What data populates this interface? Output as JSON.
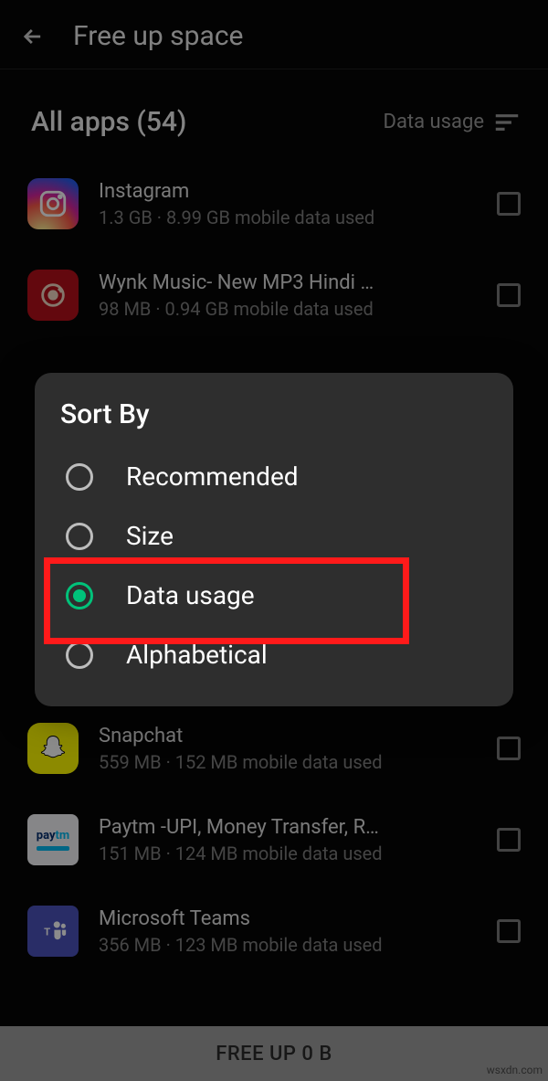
{
  "header": {
    "title": "Free up space"
  },
  "section": {
    "title": "All apps (54)",
    "sort_label": "Data usage"
  },
  "apps": [
    {
      "name": "Instagram",
      "sub": "1.3 GB · 8.99 GB mobile data used"
    },
    {
      "name": "Wynk Music- New MP3 Hindi …",
      "sub": "98 MB · 0.94 GB mobile data used"
    },
    {
      "name": "Snapchat",
      "sub": "559 MB · 152 MB mobile data used"
    },
    {
      "name": "Paytm -UPI, Money Transfer, R…",
      "sub": "151 MB · 124 MB mobile data used"
    },
    {
      "name": "Microsoft Teams",
      "sub": "356 MB · 123 MB mobile data used"
    }
  ],
  "dialog": {
    "title": "Sort By",
    "options": {
      "recommended": "Recommended",
      "size": "Size",
      "data_usage": "Data usage",
      "alphabetical": "Alphabetical"
    }
  },
  "bottom": {
    "label": "FREE UP 0 B"
  },
  "watermark": "wsxdn.com"
}
